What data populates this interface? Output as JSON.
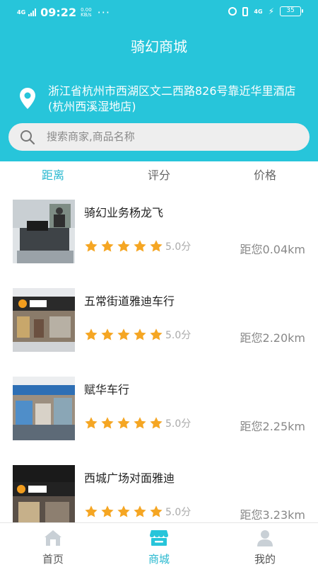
{
  "status_bar": {
    "network": "4G",
    "time": "09:22",
    "speed_value": "0.00",
    "speed_unit": "KB/s",
    "more": "···",
    "network_right": "4G",
    "battery": "35"
  },
  "header": {
    "title": "骑幻商城",
    "address": "浙江省杭州市西湖区文二西路826号靠近华里酒店(杭州西溪湿地店)"
  },
  "search": {
    "placeholder": "搜索商家,商品名称"
  },
  "sort_tabs": [
    {
      "label": "距离",
      "active": true
    },
    {
      "label": "评分",
      "active": false
    },
    {
      "label": "价格",
      "active": false
    }
  ],
  "shops": [
    {
      "name": "骑幻业务杨龙飞",
      "rating": 5,
      "score_label": "5.0分",
      "distance": "距您0.04km"
    },
    {
      "name": "五常街道雅迪车行",
      "rating": 5,
      "score_label": "5.0分",
      "distance": "距您2.20km"
    },
    {
      "name": "赋华车行",
      "rating": 5,
      "score_label": "5.0分",
      "distance": "距您2.25km"
    },
    {
      "name": "西城广场对面雅迪",
      "rating": 5,
      "score_label": "5.0分",
      "distance": "距您3.23km"
    }
  ],
  "tabbar": [
    {
      "label": "首页",
      "icon": "home-icon",
      "active": false
    },
    {
      "label": "商城",
      "icon": "shop-icon",
      "active": true
    },
    {
      "label": "我的",
      "icon": "user-icon",
      "active": false
    }
  ],
  "colors": {
    "accent": "#27c5da",
    "star": "#f5a623",
    "active_text": "#27b8cf"
  }
}
